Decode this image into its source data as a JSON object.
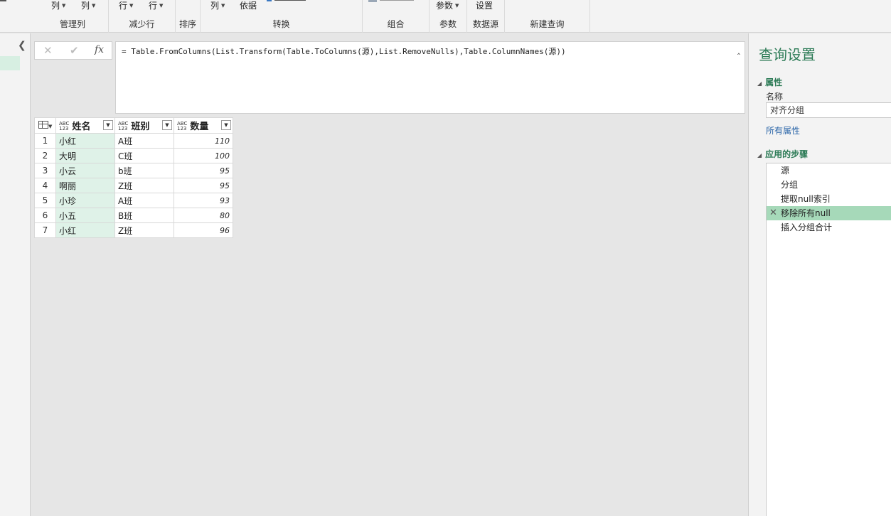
{
  "ribbon": {
    "groups": [
      {
        "id": "manage_columns",
        "label": "管理列",
        "items": [
          "列",
          "列"
        ]
      },
      {
        "id": "reduce_rows",
        "label": "减少行",
        "items": [
          "行",
          "行"
        ]
      },
      {
        "id": "sort",
        "label": "排序",
        "items": []
      },
      {
        "id": "transform",
        "label": "转换",
        "items": [
          "列",
          "依据"
        ]
      },
      {
        "id": "combine",
        "label": "组合",
        "items": []
      },
      {
        "id": "parameters",
        "label": "参数",
        "items": [
          "参数"
        ]
      },
      {
        "id": "datasource",
        "label": "数据源",
        "items": [
          "设置"
        ]
      },
      {
        "id": "new_query",
        "label": "新建查询",
        "items": []
      }
    ]
  },
  "formula_bar": {
    "fx_label": "fx",
    "formula": "= Table.FromColumns(List.Transform(Table.ToColumns(源),List.RemoveNulls),Table.ColumnNames(源))"
  },
  "table": {
    "type_label_top": "ABC",
    "type_label_bottom": "123",
    "columns": [
      "姓名",
      "班别",
      "数量"
    ],
    "rows": [
      {
        "n": "1",
        "name": "小红",
        "class": "A班",
        "qty": "110"
      },
      {
        "n": "2",
        "name": "大明",
        "class": "C班",
        "qty": "100"
      },
      {
        "n": "3",
        "name": "小云",
        "class": "b班",
        "qty": "95"
      },
      {
        "n": "4",
        "name": "啊丽",
        "class": "Z班",
        "qty": "95"
      },
      {
        "n": "5",
        "name": "小珍",
        "class": "A班",
        "qty": "93"
      },
      {
        "n": "6",
        "name": "小五",
        "class": "B班",
        "qty": "80"
      },
      {
        "n": "7",
        "name": "小红",
        "class": "Z班",
        "qty": "96"
      }
    ]
  },
  "query_settings": {
    "title": "查询设置",
    "properties_header": "属性",
    "name_label": "名称",
    "name_value": "对齐分组",
    "all_properties_link": "所有属性",
    "applied_steps_header": "应用的步骤",
    "steps": [
      "源",
      "分组",
      "提取null索引",
      "移除所有null",
      "插入分组合计"
    ],
    "active_step": 3
  },
  "colors": {
    "accent_green": "#2b7a55",
    "selected_step": "#a6d9b9",
    "name_column_highlight": "#dff2e8",
    "link_blue": "#2a65a8"
  },
  "icons": [
    "collapse-left-icon",
    "cancel-icon",
    "confirm-icon",
    "fx-icon",
    "expand-formula-icon",
    "table-menu-icon",
    "type-any-icon",
    "filter-dropdown-icon",
    "delete-step-icon"
  ]
}
